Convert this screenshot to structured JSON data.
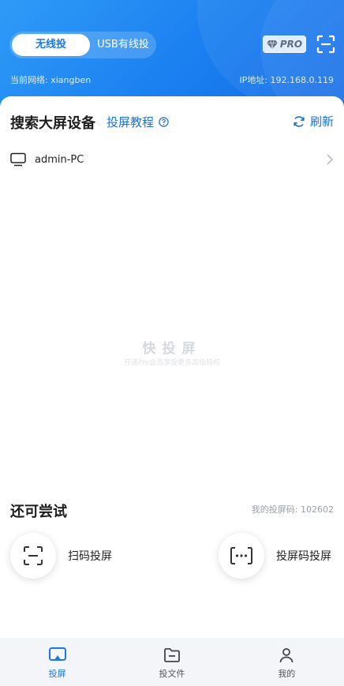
{
  "header": {
    "mode_tabs": [
      "无线投",
      "USB有线投"
    ],
    "pro_badge": "PRO",
    "network_label": "当前网络: xiangben",
    "ip_label": "IP地址: 192.168.0.119"
  },
  "devices": {
    "title": "搜索大屏设备",
    "tutorial": "投屏教程",
    "refresh": "刷新",
    "items": [
      {
        "name": "admin-PC",
        "icon": "monitor-icon"
      }
    ]
  },
  "empty": {
    "brand": "快投屏",
    "subtitle": "开通Pro会员享受更多高级特权"
  },
  "try": {
    "title": "还可尝试",
    "code_label": "我的投屏码: 102602",
    "options": [
      {
        "label": "扫码投屏",
        "icon": "scan-icon"
      },
      {
        "label": "投屏码投屏",
        "icon": "code-input-icon"
      }
    ]
  },
  "tabbar": {
    "items": [
      {
        "label": "投屏",
        "icon": "cast-icon",
        "active": true
      },
      {
        "label": "投文件",
        "icon": "folder-icon",
        "active": false
      },
      {
        "label": "我的",
        "icon": "user-icon",
        "active": false
      }
    ]
  },
  "colors": {
    "accent": "#1a78ee",
    "link": "#1f6fd8"
  }
}
